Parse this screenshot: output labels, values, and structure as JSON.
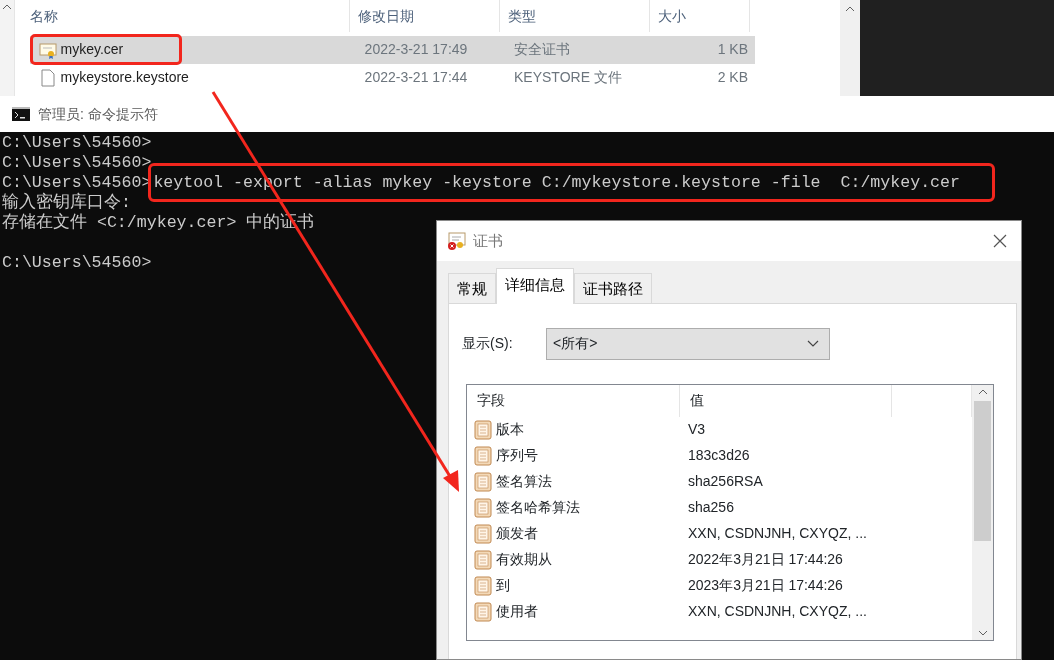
{
  "explorer": {
    "columns": [
      "名称",
      "修改日期",
      "类型",
      "大小"
    ],
    "files": [
      {
        "name": "mykey.cer",
        "modified": "2022-3-21 17:49",
        "type": "安全证书",
        "size": "1 KB",
        "kind": "certificate",
        "selected": true,
        "highlighted": true
      },
      {
        "name": "mykeystore.keystore",
        "modified": "2022-3-21 17:44",
        "type": "KEYSTORE 文件",
        "size": "2 KB",
        "kind": "file",
        "selected": false,
        "highlighted": false
      }
    ]
  },
  "console": {
    "title": "管理员: 命令提示符",
    "lines": [
      {
        "text": "C:\\Users\\54560>"
      },
      {
        "text": "C:\\Users\\54560>"
      },
      {
        "prompt": "C:\\Users\\54560>",
        "command": "keytool -export -alias mykey -keystore C:/mykeystore.keystore -file  C:/mykey.cer",
        "highlighted": true
      },
      {
        "text": "输入密钥库口令:"
      },
      {
        "text": "存储在文件 <C:/mykey.cer> 中的证书"
      },
      {
        "text": "C:\\Users\\54560>",
        "gap_before": true
      }
    ]
  },
  "certificate_dialog": {
    "title": "证书",
    "tabs": [
      {
        "label": "常规",
        "selected": false
      },
      {
        "label": "详细信息",
        "selected": true
      },
      {
        "label": "证书路径",
        "selected": false
      }
    ],
    "show_label": "显示(S):",
    "show_value": "<所有>",
    "columns": [
      "字段",
      "值"
    ],
    "fields": [
      {
        "field": "版本",
        "value": "V3"
      },
      {
        "field": "序列号",
        "value": "183c3d26"
      },
      {
        "field": "签名算法",
        "value": "sha256RSA"
      },
      {
        "field": "签名哈希算法",
        "value": "sha256"
      },
      {
        "field": "颁发者",
        "value": "XXN, CSDNJNH, CXYQZ, ..."
      },
      {
        "field": "有效期从",
        "value": "2022年3月21日 17:44:26"
      },
      {
        "field": "到",
        "value": "2023年3月21日 17:44:26"
      },
      {
        "field": "使用者",
        "value": "XXN, CSDNJNH, CXYQZ, ..."
      }
    ]
  }
}
